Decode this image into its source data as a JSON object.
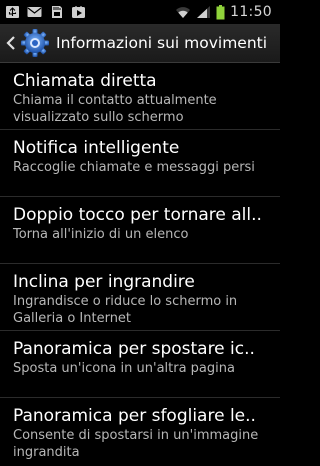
{
  "status_bar": {
    "time": "11:50",
    "icons": [
      "usb-icon",
      "mail-icon",
      "sd-card-icon",
      "play-store-icon",
      "wifi-icon",
      "signal-icon",
      "battery-icon"
    ],
    "battery_color": "#8fd23a"
  },
  "header": {
    "title": "Informazioni sui movimenti",
    "icon": "gear-icon",
    "back_icon": "back-chevron-icon"
  },
  "items": [
    {
      "title": "Chiamata diretta",
      "subtitle": "Chiama il contatto attualmente visualizzato sullo schermo"
    },
    {
      "title": "Notifica intelligente",
      "subtitle": "Raccoglie chiamate e messaggi persi"
    },
    {
      "title": "Doppio tocco per tornare all..",
      "subtitle": "Torna all'inizio di un elenco"
    },
    {
      "title": "Inclina per ingrandire",
      "subtitle": "Ingrandisce o riduce lo schermo in Galleria o Internet"
    },
    {
      "title": "Panoramica per spostare ic..",
      "subtitle": "Sposta un'icona in un'altra pagina"
    },
    {
      "title": "Panoramica per sfogliare le..",
      "subtitle": "Consente di spostarsi in un'immagine ingrandita"
    }
  ]
}
